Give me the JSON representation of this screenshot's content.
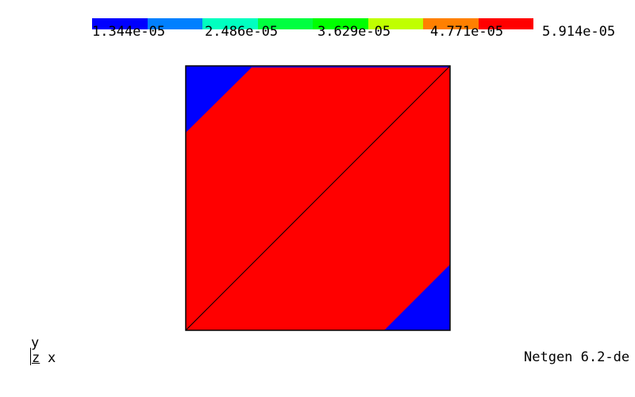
{
  "colorbar": {
    "colors": [
      "#0000ff",
      "#0080ff",
      "#00ffc0",
      "#00ff40",
      "#00ff00",
      "#c0ff00",
      "#ff8000",
      "#ff0000"
    ],
    "labels": [
      "1.344e-05",
      "2.486e-05",
      "3.629e-05",
      "4.771e-05",
      "5.914e-05"
    ]
  },
  "mesh": {
    "background_color": "#0000ff",
    "field_color": "#ff0000",
    "edge_color": "#000000"
  },
  "axes": {
    "y": "y",
    "z": "z",
    "x": "x"
  },
  "footer": {
    "version": "Netgen 6.2-de"
  }
}
